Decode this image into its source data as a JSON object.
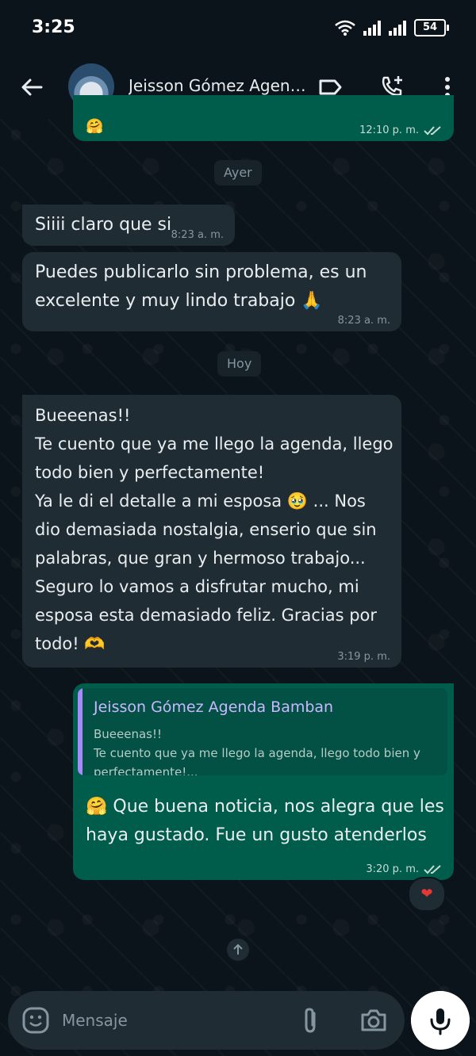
{
  "status_bar": {
    "time": "3:25",
    "battery": "54"
  },
  "header": {
    "contact_name": "Jeisson Gómez Agenda...",
    "icons": [
      "back-arrow-icon",
      "label-icon",
      "add-call-icon",
      "more-vert-icon"
    ]
  },
  "messages": [
    {
      "type": "outgoing",
      "text": "",
      "time": "12:10 p. m.",
      "status": "read"
    },
    {
      "type": "date",
      "text": "Ayer"
    },
    {
      "type": "incoming",
      "text": "Siiii claro que si",
      "time": "8:23 a. m."
    },
    {
      "type": "incoming",
      "text": "Puedes publicarlo sin problema, es un\nexcelente y muy lindo trabajo 🙏",
      "time": "8:23 a. m."
    },
    {
      "type": "date",
      "text": "Hoy"
    },
    {
      "type": "incoming",
      "text": "Bueeenas!!\nTe cuento que ya me llego la agenda, llego\ntodo bien y perfectamente!\nYa le di el detalle a mi esposa 🥹 ... Nos\ndio demasiada nostalgia, enserio que sin\npalabras, que gran y hermoso trabajo...\nSeguro lo vamos a disfrutar mucho, mi\nesposa esta demasiado feliz. Gracias por\ntodo! 🫶",
      "time": "3:19 p. m."
    },
    {
      "type": "outgoing",
      "quote_name": "Jeisson Gómez Agenda Bamban",
      "quote_text": "Bueeenas!!\nTe cuento que ya me llego la agenda, llego todo bien y\nperfectamente!...",
      "text": "🤗 Que buena noticia, nos alegra que les\nhaya gustado. Fue un gusto atenderlos",
      "time": "3:20 p. m.",
      "status": "read",
      "reaction": "❤"
    }
  ],
  "composer": {
    "placeholder": "Mensaje"
  },
  "colors": {
    "incoming_bubble": "#202c33",
    "outgoing_bubble": "#005c4b",
    "background": "#0b141a",
    "quote_bar": "#a78bfa"
  }
}
